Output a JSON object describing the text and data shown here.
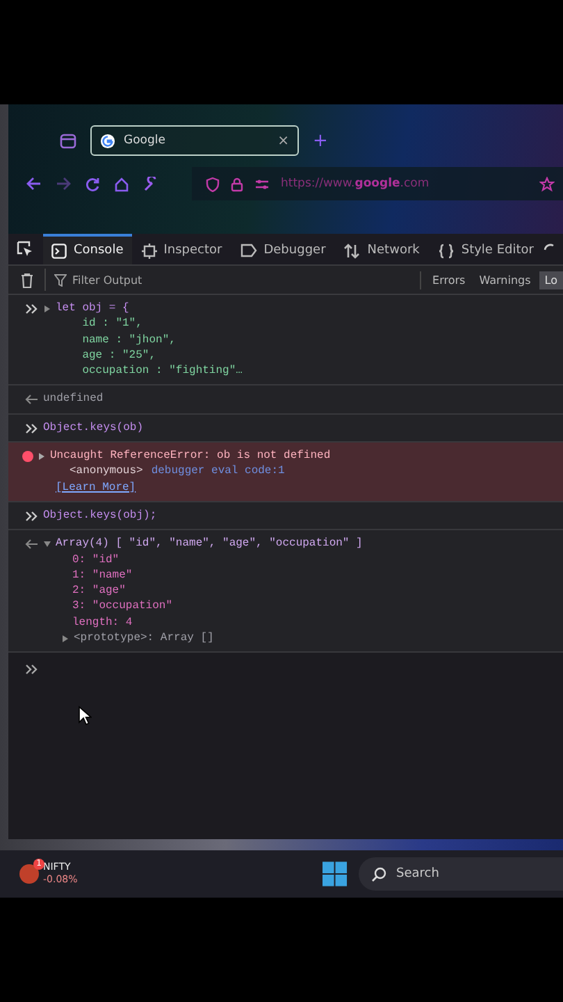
{
  "browser": {
    "tab": {
      "title": "Google",
      "close": "×",
      "selected": true
    },
    "new_tab": "+",
    "url": "https://www.**google**.com"
  },
  "devtools": {
    "tabs": [
      {
        "label": "Console",
        "selected": true,
        "kind": "console"
      },
      {
        "label": "Inspector",
        "selected": false,
        "kind": "inspector"
      },
      {
        "label": "Debugger",
        "selected": false,
        "kind": "debugger"
      },
      {
        "label": "Network",
        "selected": false,
        "kind": "network"
      },
      {
        "label": "Style Editor",
        "selected": false,
        "kind": "style"
      }
    ],
    "filter": {
      "placeholder": "Filter Output"
    },
    "levels": [
      {
        "label": "Errors",
        "selected": false
      },
      {
        "label": "Warnings",
        "selected": false
      },
      {
        "label": "Lo",
        "selected": true
      }
    ]
  },
  "console": [
    {
      "kind": "input",
      "expanded": false,
      "lines": [
        "let obj = {",
        "    id : \"1\",",
        "    name : \"jhon\",",
        "    age : \"25\",",
        "    occupation : \"fighting\"…"
      ]
    },
    {
      "kind": "result",
      "text": "undefined"
    },
    {
      "kind": "input",
      "lines": [
        "Object.keys(ob)"
      ]
    },
    {
      "kind": "error",
      "expanded": false,
      "message": "Uncaught ReferenceError: ob is not defined",
      "frame": "<anonymous>",
      "location": "debugger eval code:1",
      "link": "[Learn More]"
    },
    {
      "kind": "input",
      "lines": [
        "Object.keys(obj);"
      ]
    },
    {
      "kind": "array",
      "expanded": true,
      "text": "Array(4) [ \"id\", \"name\", \"age\", \"occupation\" ]",
      "children": [
        "0: \"id\"",
        "1: \"name\"",
        "2: \"age\"",
        "3: \"occupation\"",
        "length: 4"
      ],
      "prototype": {
        "text": "<prototype>: Array []",
        "expanded": false
      }
    }
  ],
  "taskbar": {
    "ticker": {
      "name": "NIFTY",
      "change": "-0.08%",
      "badge": "1"
    },
    "search": {
      "placeholder": "Search"
    }
  }
}
